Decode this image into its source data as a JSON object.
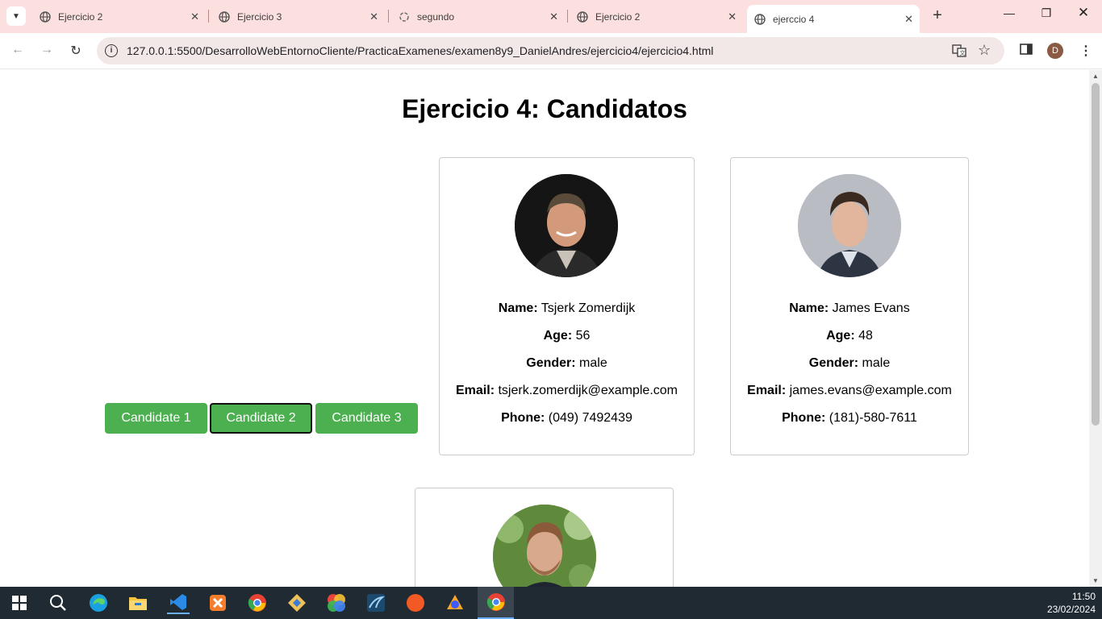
{
  "browser": {
    "tabs": [
      {
        "title": "Ejercicio 2"
      },
      {
        "title": "Ejercicio 3"
      },
      {
        "title": "segundo"
      },
      {
        "title": "Ejercicio 2"
      },
      {
        "title": "ejerccio 4"
      }
    ],
    "url": "127.0.0.1:5500/DesarrolloWebEntornoCliente/PracticaExamenes/examen8y9_DanielAndres/ejercicio4/ejercicio4.html",
    "profile_initial": "D"
  },
  "page": {
    "title": "Ejercicio 4: Candidatos",
    "buttons": [
      {
        "label": "Candidate 1"
      },
      {
        "label": "Candidate 2"
      },
      {
        "label": "Candidate 3"
      }
    ],
    "field_labels": {
      "name": "Name:",
      "age": "Age:",
      "gender": "Gender:",
      "email": "Email:",
      "phone": "Phone:"
    },
    "candidates": [
      {
        "name": "Tsjerk Zomerdijk",
        "age": "56",
        "gender": "male",
        "email": "tsjerk.zomerdijk@example.com",
        "phone": "(049) 7492439"
      },
      {
        "name": "James Evans",
        "age": "48",
        "gender": "male",
        "email": "james.evans@example.com",
        "phone": "(181)-580-7611"
      }
    ]
  },
  "taskbar": {
    "time": "11:50",
    "date": "23/02/2024"
  },
  "colors": {
    "button_green": "#4caf50",
    "tabbar_bg": "#fce0df",
    "taskbar_bg": "#1f2a33"
  }
}
